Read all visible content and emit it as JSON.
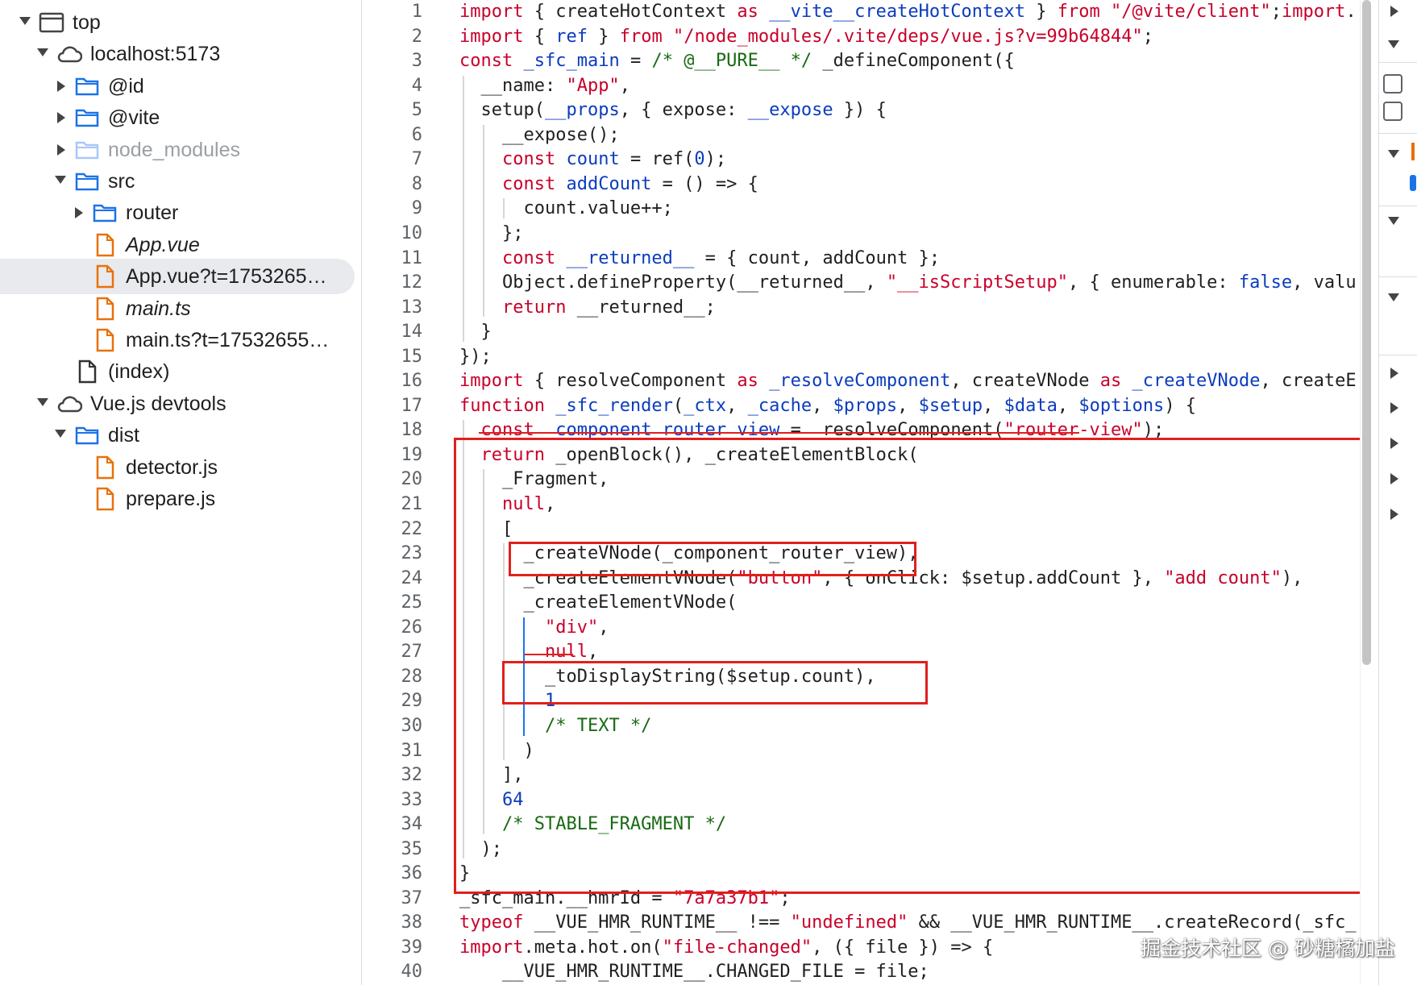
{
  "tree": [
    {
      "label": "top",
      "depth": 0,
      "arrow": "down",
      "icon": "frame-icon",
      "style": ""
    },
    {
      "label": "localhost:5173",
      "depth": 1,
      "arrow": "down",
      "icon": "cloud-icon",
      "style": ""
    },
    {
      "label": "@id",
      "depth": 2,
      "arrow": "right",
      "icon": "folder-icon",
      "style": ""
    },
    {
      "label": "@vite",
      "depth": 2,
      "arrow": "right",
      "icon": "folder-icon",
      "style": ""
    },
    {
      "label": "node_modules",
      "depth": 2,
      "arrow": "right",
      "icon": "folder-icon-faded",
      "style": "faded"
    },
    {
      "label": "src",
      "depth": 2,
      "arrow": "down",
      "icon": "folder-icon",
      "style": ""
    },
    {
      "label": "router",
      "depth": 3,
      "arrow": "right",
      "icon": "folder-icon",
      "style": ""
    },
    {
      "label": "App.vue",
      "depth": 3,
      "arrow": "",
      "icon": "file-orange-icon",
      "style": "italic"
    },
    {
      "label": "App.vue?t=1753265…",
      "depth": 3,
      "arrow": "",
      "icon": "file-orange-icon",
      "style": "selected"
    },
    {
      "label": "main.ts",
      "depth": 3,
      "arrow": "",
      "icon": "file-orange-icon",
      "style": "italic"
    },
    {
      "label": "main.ts?t=17532655…",
      "depth": 3,
      "arrow": "",
      "icon": "file-orange-icon",
      "style": ""
    },
    {
      "label": "(index)",
      "depth": 2,
      "arrow": "",
      "icon": "file-icon",
      "style": ""
    },
    {
      "label": "Vue.js devtools",
      "depth": 1,
      "arrow": "down",
      "icon": "cloud-icon",
      "style": ""
    },
    {
      "label": "dist",
      "depth": 2,
      "arrow": "down",
      "icon": "folder-icon",
      "style": ""
    },
    {
      "label": "detector.js",
      "depth": 3,
      "arrow": "",
      "icon": "file-orange-icon",
      "style": ""
    },
    {
      "label": "prepare.js",
      "depth": 3,
      "arrow": "",
      "icon": "file-orange-icon",
      "style": ""
    }
  ],
  "code": [
    {
      "n": "1",
      "t": [
        [
          "kw",
          "import"
        ],
        [
          "p",
          " { createHotContext "
        ],
        [
          "kw",
          "as"
        ],
        [
          "p",
          " "
        ],
        [
          "id",
          "__vite__createHotContext"
        ],
        [
          "p",
          " } "
        ],
        [
          "kw",
          "from"
        ],
        [
          "p",
          " "
        ],
        [
          "str",
          "\"/@vite/client\""
        ],
        [
          "p",
          ";"
        ],
        [
          "kw",
          "import"
        ],
        [
          "p",
          "."
        ]
      ]
    },
    {
      "n": "2",
      "t": [
        [
          "kw",
          "import"
        ],
        [
          "p",
          " { "
        ],
        [
          "id",
          "ref"
        ],
        [
          "p",
          " } "
        ],
        [
          "kw",
          "from"
        ],
        [
          "p",
          " "
        ],
        [
          "str",
          "\"/node_modules/.vite/deps/vue.js?v=99b64844\""
        ],
        [
          "p",
          ";"
        ]
      ]
    },
    {
      "n": "3",
      "t": [
        [
          "kw",
          "const"
        ],
        [
          "p",
          " "
        ],
        [
          "id",
          "_sfc_main"
        ],
        [
          "p",
          " = "
        ],
        [
          "com",
          "/* @__PURE__ */"
        ],
        [
          "p",
          " _defineComponent({"
        ]
      ]
    },
    {
      "n": "4",
      "t": [
        [
          "p",
          "  __name: "
        ],
        [
          "str",
          "\"App\""
        ],
        [
          "p",
          ","
        ]
      ]
    },
    {
      "n": "5",
      "t": [
        [
          "p",
          "  setup("
        ],
        [
          "id",
          "__props"
        ],
        [
          "p",
          ", { expose: "
        ],
        [
          "id",
          "__expose"
        ],
        [
          "p",
          " }) {"
        ]
      ]
    },
    {
      "n": "6",
      "t": [
        [
          "p",
          "    __expose();"
        ]
      ]
    },
    {
      "n": "7",
      "t": [
        [
          "p",
          "    "
        ],
        [
          "kw",
          "const"
        ],
        [
          "p",
          " "
        ],
        [
          "id",
          "count"
        ],
        [
          "p",
          " = ref("
        ],
        [
          "num",
          "0"
        ],
        [
          "p",
          ");"
        ]
      ]
    },
    {
      "n": "8",
      "t": [
        [
          "p",
          "    "
        ],
        [
          "kw",
          "const"
        ],
        [
          "p",
          " "
        ],
        [
          "id",
          "addCount"
        ],
        [
          "p",
          " = () => {"
        ]
      ]
    },
    {
      "n": "9",
      "t": [
        [
          "p",
          "      count.value++;"
        ]
      ]
    },
    {
      "n": "10",
      "t": [
        [
          "p",
          "    };"
        ]
      ]
    },
    {
      "n": "11",
      "t": [
        [
          "p",
          "    "
        ],
        [
          "kw",
          "const"
        ],
        [
          "p",
          " "
        ],
        [
          "id",
          "__returned__"
        ],
        [
          "p",
          " = { count, addCount };"
        ]
      ]
    },
    {
      "n": "12",
      "t": [
        [
          "p",
          "    Object.defineProperty(__returned__, "
        ],
        [
          "str",
          "\"__isScriptSetup\""
        ],
        [
          "p",
          ", { enumerable: "
        ],
        [
          "id",
          "false"
        ],
        [
          "p",
          ", valu"
        ]
      ]
    },
    {
      "n": "13",
      "t": [
        [
          "p",
          "    "
        ],
        [
          "kw",
          "return"
        ],
        [
          "p",
          " __returned__;"
        ]
      ]
    },
    {
      "n": "14",
      "t": [
        [
          "p",
          "  }"
        ]
      ]
    },
    {
      "n": "15",
      "t": [
        [
          "p",
          "});"
        ]
      ]
    },
    {
      "n": "16",
      "t": [
        [
          "kw",
          "import"
        ],
        [
          "p",
          " { resolveComponent "
        ],
        [
          "kw",
          "as"
        ],
        [
          "p",
          " "
        ],
        [
          "id",
          "_resolveComponent"
        ],
        [
          "p",
          ", createVNode "
        ],
        [
          "kw",
          "as"
        ],
        [
          "p",
          " "
        ],
        [
          "id",
          "_createVNode"
        ],
        [
          "p",
          ", createE"
        ]
      ]
    },
    {
      "n": "17",
      "t": [
        [
          "kw",
          "function"
        ],
        [
          "p",
          " "
        ],
        [
          "id",
          "_sfc_render"
        ],
        [
          "p",
          "("
        ],
        [
          "id",
          "_ctx"
        ],
        [
          "p",
          ", "
        ],
        [
          "id",
          "_cache"
        ],
        [
          "p",
          ", "
        ],
        [
          "id",
          "$props"
        ],
        [
          "p",
          ", "
        ],
        [
          "id",
          "$setup"
        ],
        [
          "p",
          ", "
        ],
        [
          "id",
          "$data"
        ],
        [
          "p",
          ", "
        ],
        [
          "id",
          "$options"
        ],
        [
          "p",
          ") {"
        ]
      ]
    },
    {
      "n": "18",
      "t": [
        [
          "p",
          "  "
        ],
        [
          "kw",
          "const"
        ],
        [
          "p",
          " "
        ],
        [
          "id",
          "_component_router_view"
        ],
        [
          "p",
          " = _resolveComponent("
        ],
        [
          "str",
          "\"router-view\""
        ],
        [
          "p",
          ");"
        ]
      ]
    },
    {
      "n": "19",
      "t": [
        [
          "p",
          "  "
        ],
        [
          "kw",
          "return"
        ],
        [
          "p",
          " _openBlock(), _createElementBlock("
        ]
      ]
    },
    {
      "n": "20",
      "t": [
        [
          "p",
          "    _Fragment,"
        ]
      ]
    },
    {
      "n": "21",
      "t": [
        [
          "p",
          "    "
        ],
        [
          "kw",
          "null"
        ],
        [
          "p",
          ","
        ]
      ]
    },
    {
      "n": "22",
      "t": [
        [
          "p",
          "    ["
        ]
      ]
    },
    {
      "n": "23",
      "t": [
        [
          "p",
          "      _createVNode(_component_router_view),"
        ]
      ]
    },
    {
      "n": "24",
      "t": [
        [
          "p",
          "      _createElementVNode("
        ],
        [
          "str",
          "\"button\""
        ],
        [
          "p",
          ", { onClick: $setup.addCount }, "
        ],
        [
          "str",
          "\"add count\""
        ],
        [
          "p",
          "),"
        ]
      ]
    },
    {
      "n": "25",
      "t": [
        [
          "p",
          "      _createElementVNode("
        ]
      ]
    },
    {
      "n": "26",
      "t": [
        [
          "p",
          "        "
        ],
        [
          "str",
          "\"div\""
        ],
        [
          "p",
          ","
        ]
      ]
    },
    {
      "n": "27",
      "t": [
        [
          "p",
          "        "
        ],
        [
          "kw",
          "null"
        ],
        [
          "p",
          ","
        ]
      ]
    },
    {
      "n": "28",
      "t": [
        [
          "p",
          "        _toDisplayString($setup.count),"
        ]
      ]
    },
    {
      "n": "29",
      "t": [
        [
          "p",
          "        "
        ],
        [
          "num",
          "1"
        ]
      ]
    },
    {
      "n": "30",
      "t": [
        [
          "p",
          "        "
        ],
        [
          "com",
          "/* TEXT */"
        ]
      ]
    },
    {
      "n": "31",
      "t": [
        [
          "p",
          "      )"
        ]
      ]
    },
    {
      "n": "32",
      "t": [
        [
          "p",
          "    ],"
        ]
      ]
    },
    {
      "n": "33",
      "t": [
        [
          "p",
          "    "
        ],
        [
          "num",
          "64"
        ]
      ]
    },
    {
      "n": "34",
      "t": [
        [
          "p",
          "    "
        ],
        [
          "com",
          "/* STABLE_FRAGMENT */"
        ]
      ]
    },
    {
      "n": "35",
      "t": [
        [
          "p",
          "  );"
        ]
      ]
    },
    {
      "n": "36",
      "t": [
        [
          "p",
          "}"
        ]
      ]
    },
    {
      "n": "37",
      "t": [
        [
          "p",
          "_sfc_main.__hmrId = "
        ],
        [
          "str",
          "\"7a7a37b1\""
        ],
        [
          "p",
          ";"
        ]
      ]
    },
    {
      "n": "38",
      "t": [
        [
          "kw",
          "typeof"
        ],
        [
          "p",
          " __VUE_HMR_RUNTIME__ !== "
        ],
        [
          "str",
          "\"undefined\""
        ],
        [
          "p",
          " && __VUE_HMR_RUNTIME__.createRecord(_sfc_"
        ]
      ]
    },
    {
      "n": "39",
      "t": [
        [
          "kw",
          "import"
        ],
        [
          "p",
          ".meta.hot.on("
        ],
        [
          "str",
          "\"file-changed\""
        ],
        [
          "p",
          ", ({ file }) => {"
        ]
      ]
    },
    {
      "n": "40",
      "t": [
        [
          "p",
          "    __VUE_HMR_RUNTIME__.CHANGED_FILE = file;"
        ]
      ]
    }
  ],
  "watermark": "掘金技术社区 @ 砂糖橘加盐",
  "colors": {
    "keyword": "#c8002a",
    "identifier": "#0b3cbe",
    "comment": "#186a12",
    "highlight": "#e0201c",
    "file": "#e8710a",
    "folder": "#1a73e8"
  }
}
